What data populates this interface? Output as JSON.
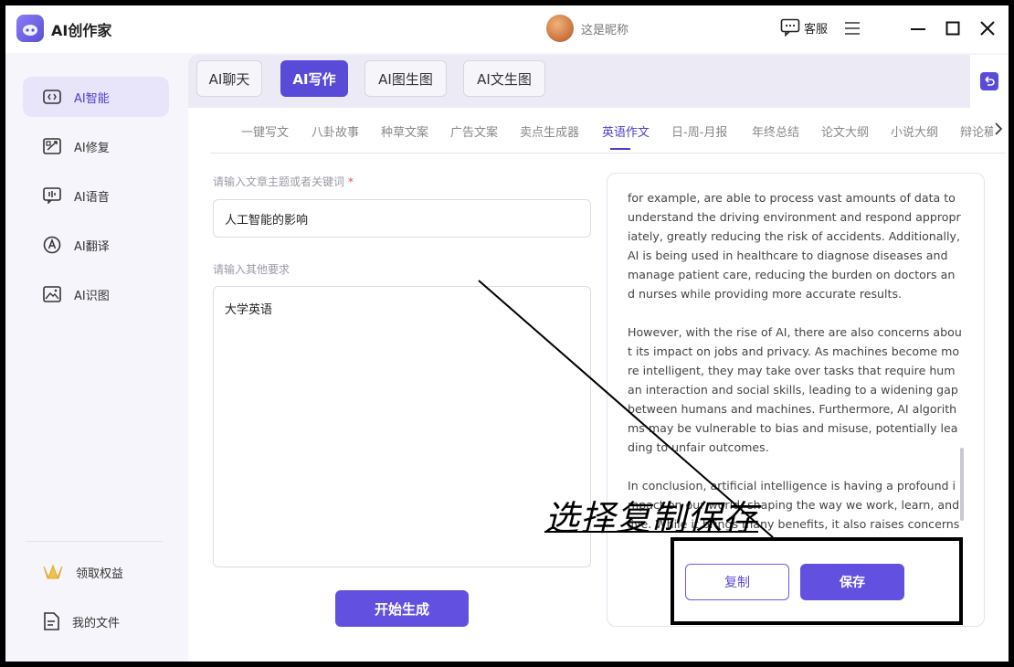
{
  "app": {
    "title": "AI创作家",
    "nickname": "这是昵称",
    "service_label": "客服"
  },
  "sidebar": {
    "items": [
      {
        "label": "AI智能",
        "icon": "ai-chat-icon"
      },
      {
        "label": "AI修复",
        "icon": "image-repair-icon"
      },
      {
        "label": "AI语音",
        "icon": "voice-icon"
      },
      {
        "label": "AI翻译",
        "icon": "translate-icon"
      },
      {
        "label": "AI识图",
        "icon": "image-recognize-icon"
      }
    ],
    "bottom": [
      {
        "label": "领取权益",
        "icon": "crown-icon"
      },
      {
        "label": "我的文件",
        "icon": "file-icon"
      }
    ]
  },
  "tabs": [
    "AI聊天",
    "AI写作",
    "AI图生图",
    "AI文生图"
  ],
  "active_tab": "AI写作",
  "subtabs": [
    "一键写文",
    "八卦故事",
    "种草文案",
    "广告文案",
    "卖点生成器",
    "英语作文",
    "日-周-月报",
    "年终总结",
    "论文大纲",
    "小说大纲",
    "辩论稿"
  ],
  "active_subtab": "英语作文",
  "form": {
    "topic_label": "请输入文章主题或者关键词",
    "required_mark": "*",
    "topic_value": "人工智能的影响",
    "other_label": "请输入其他要求",
    "other_value": "大学英语",
    "generate_label": "开始生成"
  },
  "output": {
    "paragraphs": [
      "for example, are able to process vast amounts of data to understand the driving environment and respond appropriately, greatly reducing the risk of accidents. Additionally, AI is being used in healthcare to diagnose diseases and manage patient care, reducing the burden on doctors and nurses while providing more accurate results.",
      "However, with the rise of AI, there are also concerns about its impact on jobs and privacy. As machines become more intelligent, they may take over tasks that require human interaction and social skills, leading to a widening gap between humans and machines. Furthermore, AI algorithms may be vulnerable to bias and misuse, potentially leading to unfair outcomes.",
      "In conclusion, artificial intelligence is having a profound impact on our world, shaping the way we work, learn, and live. While it brings many benefits, it also raises concerns abo"
    ],
    "copy_label": "复制",
    "save_label": "保存"
  },
  "annotation": {
    "text": "选择复制保存"
  },
  "colors": {
    "accent": "#6250e0",
    "active_bg": "#e8e4fa",
    "annotation": "#000000"
  }
}
